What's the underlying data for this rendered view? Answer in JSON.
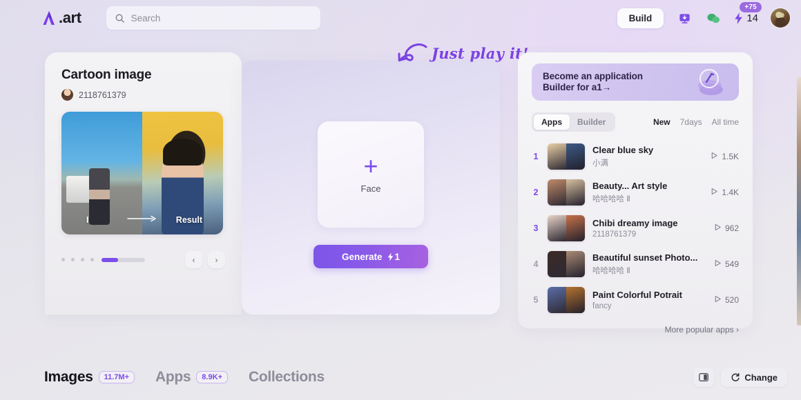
{
  "header": {
    "logo_text": ".art",
    "logo_icon": "a-art-logo-icon",
    "search": {
      "placeholder": "Search",
      "value": "",
      "icon": "search-icon"
    },
    "build_label": "Build",
    "inbox_icon": "inbox-download-icon",
    "chat_icon": "chat-bubbles-icon",
    "credits": {
      "icon": "lightning-bolt-icon",
      "value": "14",
      "badge": "+75"
    },
    "avatar": "user-avatar"
  },
  "left_card": {
    "title": "Cartoon image",
    "author": "2118761379",
    "preview": {
      "input_label": "Input",
      "result_label": "Result",
      "arrow_icon": "arrow-right-icon"
    },
    "carousel": {
      "dots": 4,
      "prev_label": "‹",
      "next_label": "›",
      "progress_percent": 38
    }
  },
  "center_panel": {
    "upload": {
      "plus": "+",
      "label": "Face"
    },
    "generate": {
      "label": "Generate",
      "cost": "1",
      "cost_icon": "lightning-bolt-icon"
    }
  },
  "annotation": {
    "text": "Just play it!",
    "arrow_icon": "curved-arrow-left-icon"
  },
  "right_card": {
    "banner": {
      "line1": "Become an application",
      "line2": "Builder for a1→",
      "icon": "coins-icon"
    },
    "tabs": [
      {
        "label": "Apps",
        "active": true
      },
      {
        "label": "Builder",
        "active": false
      }
    ],
    "ranges": [
      {
        "label": "New",
        "active": true
      },
      {
        "label": "7days",
        "active": false
      },
      {
        "label": "All time",
        "active": false
      }
    ],
    "play_icon": "play-count-icon",
    "rows": [
      {
        "rank": "1",
        "title": "Clear blue sky",
        "author": "小满",
        "plays": "1.5K",
        "c1": "#e8cfa6",
        "c2": "#3c5a86"
      },
      {
        "rank": "2",
        "title": "Beauty... Art style",
        "author": "哈哈哈哈 Ⅱ",
        "plays": "1.4K",
        "c1": "#c08a6a",
        "c2": "#d6c0a0"
      },
      {
        "rank": "3",
        "title": "Chibi dreamy image",
        "author": "2118761379",
        "plays": "962",
        "c1": "#e7d3c8",
        "c2": "#c8724a"
      },
      {
        "rank": "4",
        "title": "Beautiful sunset Photo...",
        "author": "哈哈哈哈 Ⅱ",
        "plays": "549",
        "c1": "#3b2a26",
        "c2": "#a98a74"
      },
      {
        "rank": "5",
        "title": "Paint Colorful Potrait",
        "author": "fancy",
        "plays": "520",
        "c1": "#5a6ea8",
        "c2": "#b4722f"
      }
    ],
    "more_label": "More popular apps",
    "more_chevron": "›"
  },
  "bottom_bar": {
    "nav": [
      {
        "label": "Images",
        "count": "11.7M+",
        "active": true
      },
      {
        "label": "Apps",
        "count": "8.9K+",
        "active": false
      },
      {
        "label": "Collections",
        "count": "",
        "active": false
      }
    ],
    "panel_icon": "panel-layout-icon",
    "change_label": "Change",
    "change_icon": "refresh-icon"
  },
  "colors": {
    "accent_purple": "#7b4ce8",
    "badge_purple": "#9b6ae0",
    "text_dark": "#1a1a21",
    "text_muted": "#8a8a97"
  }
}
